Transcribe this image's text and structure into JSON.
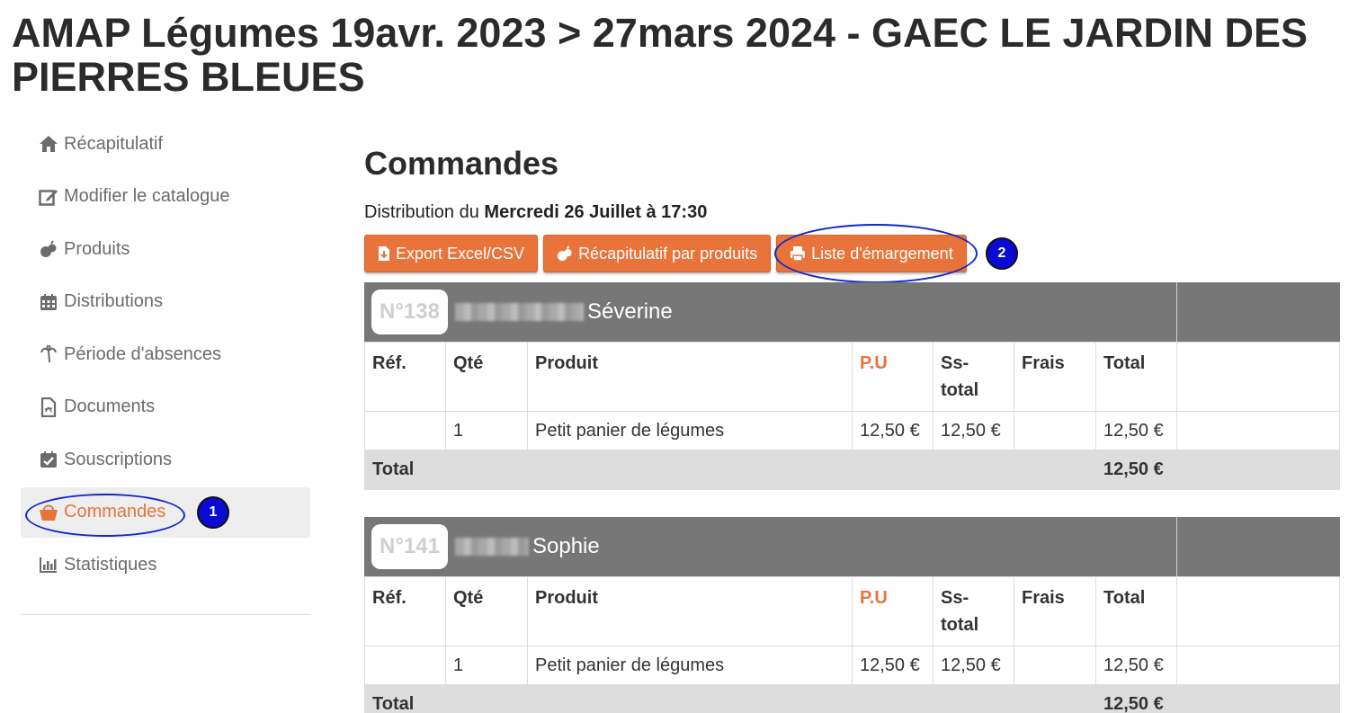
{
  "page": {
    "title": "AMAP Légumes 19avr. 2023 > 27mars 2024 - GAEC LE JARDIN DES PIERRES BLEUES"
  },
  "sidebar": {
    "items": [
      {
        "label": "Récapitulatif",
        "icon": "home-icon"
      },
      {
        "label": "Modifier le catalogue",
        "icon": "edit-icon"
      },
      {
        "label": "Produits",
        "icon": "produce-icon"
      },
      {
        "label": "Distributions",
        "icon": "calendar-icon"
      },
      {
        "label": "Période d'absences",
        "icon": "palm-tree-icon"
      },
      {
        "label": "Documents",
        "icon": "pdf-file-icon"
      },
      {
        "label": "Souscriptions",
        "icon": "calendar-check-icon"
      },
      {
        "label": "Commandes",
        "icon": "basket-icon",
        "active": true
      },
      {
        "label": "Statistiques",
        "icon": "bar-chart-icon"
      }
    ]
  },
  "annotations": {
    "badge1": "1",
    "badge2": "2"
  },
  "main": {
    "section_title": "Commandes",
    "distribution_prefix": "Distribution du",
    "distribution_date": "Mercredi 26 Juillet à 17:30",
    "buttons": {
      "export": "Export Excel/CSV",
      "recap_products": "Récapitulatif par produits",
      "sign_sheet": "Liste d'émargement"
    },
    "table_headers": {
      "ref": "Réf.",
      "qty": "Qté",
      "product": "Produit",
      "unit_price": "P.U",
      "subtotal": "Ss-total",
      "fees": "Frais",
      "total": "Total"
    },
    "orders": [
      {
        "number": "N°138",
        "name": "Séverine",
        "line": {
          "ref": "",
          "qty": "1",
          "product": "Petit panier de légumes",
          "unit_price": "12,50 €",
          "subtotal": "12,50 €",
          "fees": "",
          "total": "12,50 €"
        },
        "total_label": "Total",
        "total_value": "12,50 €"
      },
      {
        "number": "N°141",
        "name": "Sophie",
        "line": {
          "ref": "",
          "qty": "1",
          "product": "Petit panier de légumes",
          "unit_price": "12,50 €",
          "subtotal": "12,50 €",
          "fees": "",
          "total": "12,50 €"
        },
        "total_label": "Total",
        "total_value": "12,50 €"
      }
    ]
  },
  "colors": {
    "accent": "#e8743b",
    "header_gray": "#777777",
    "annotation_blue": "#1428c8"
  }
}
